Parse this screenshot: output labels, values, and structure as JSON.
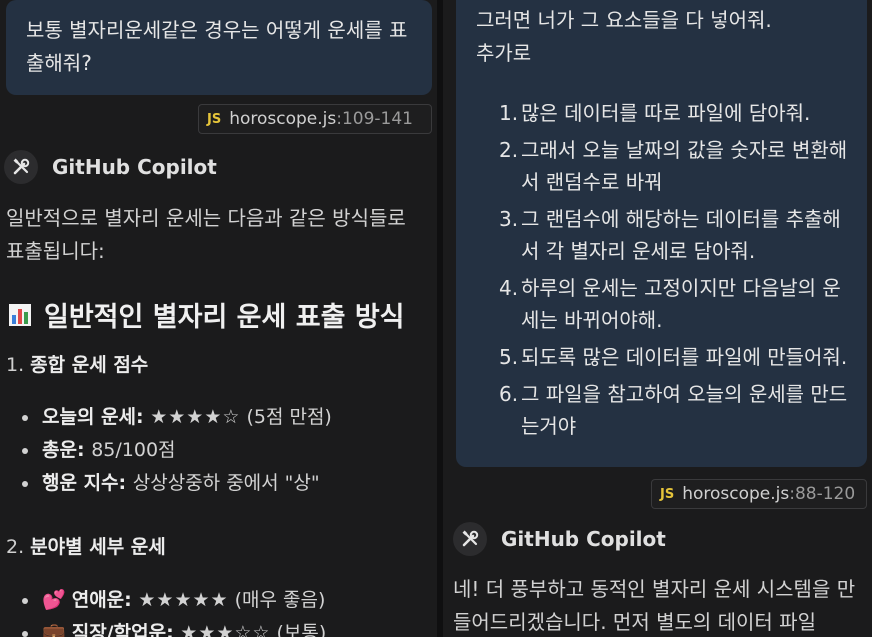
{
  "left_panel": {
    "user_message": "보통 별자리운세같은 경우는 어떻게 운세를 표출해줘?",
    "reference": {
      "file": "horoscope.js",
      "range": ":109-141"
    },
    "copilot_name": "GitHub Copilot",
    "intro": "일반적으로 별자리 운세는 다음과 같은 방식들로 표출됩니다:",
    "heading": "일반적인 별자리 운세 표출 방식",
    "section1": {
      "number": "1. ",
      "title": "종합 운세 점수",
      "items": [
        {
          "label": "오늘의 운세",
          "sep": ": ",
          "value": "★★★★☆",
          "note": " (5점 만점)"
        },
        {
          "label": "총운",
          "sep": ": ",
          "value": "85/100점",
          "note": ""
        },
        {
          "label": "행운 지수",
          "sep": ": ",
          "value": "상상상중하 중에서 \"상\"",
          "note": ""
        }
      ]
    },
    "section2": {
      "number": "2. ",
      "title": "분야별 세부 운세",
      "items": [
        {
          "emoji": "💕",
          "label": "연애운",
          "sep": ": ",
          "value": "★★★★★",
          "note": " (매우 좋음)"
        },
        {
          "emoji": "💼",
          "label": "직장/학업운",
          "sep": ": ",
          "value": "★★★☆☆",
          "note": " (보통)"
        }
      ]
    }
  },
  "right_panel": {
    "user_message_intro": "그러면 너가 그 요소들을 다 넣어줘.",
    "user_message_extra": "추가로",
    "requirements": [
      {
        "num": "1.",
        "text": "많은 데이터를 따로 파일에 담아줘."
      },
      {
        "num": "2.",
        "text": "그래서 오늘 날짜의 값을 숫자로 변환해서 랜덤수로 바꿔"
      },
      {
        "num": "3.",
        "text": "그 랜덤수에 해당하는 데이터를 추출해서 각 별자리 운세로 담아줘."
      },
      {
        "num": "4.",
        "text": "하루의 운세는 고정이지만 다음날의 운세는 바뀌어야해."
      },
      {
        "num": "5.",
        "text": "되도록 많은 데이터를 파일에 만들어줘."
      },
      {
        "num": "6.",
        "text": "그 파일을 참고하여 오늘의 운세를 만드는거야"
      }
    ],
    "reference": {
      "file": "horoscope.js",
      "range": ":88-120"
    },
    "copilot_name": "GitHub Copilot",
    "response": "네! 더 풍부하고 동적인 별자리 운세 시스템을 만들어드리겠습니다. 먼저 별도의 데이터 파일"
  },
  "colors": {
    "bubble": "#243142",
    "background": "#1b1b1c",
    "js_badge": "#e5c43a"
  }
}
